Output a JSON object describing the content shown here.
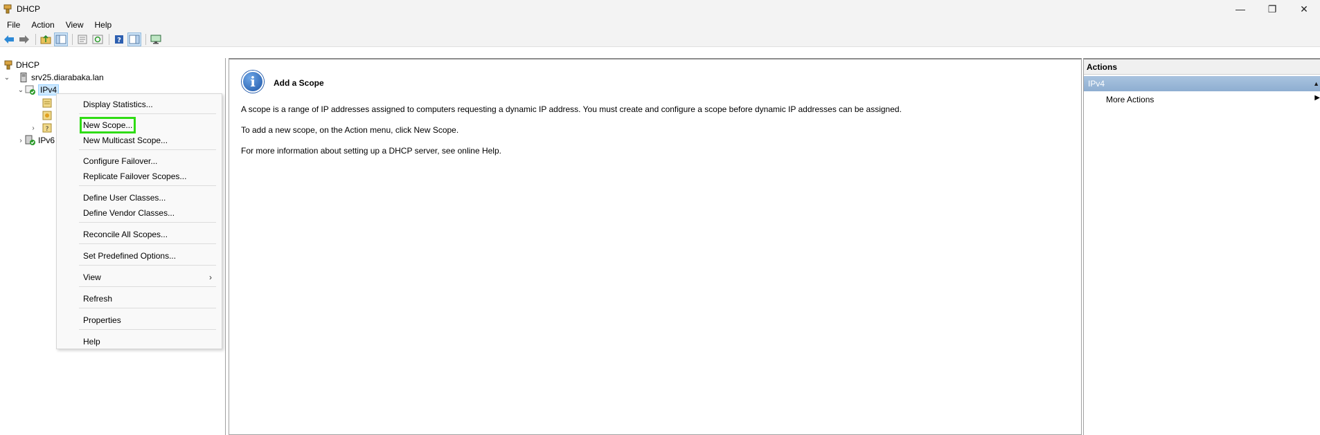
{
  "window": {
    "title": "DHCP",
    "controls": {
      "minimize": "—",
      "restore": "❐",
      "close": "✕"
    }
  },
  "menubar": {
    "items": [
      "File",
      "Action",
      "View",
      "Help"
    ]
  },
  "toolbar": {
    "buttons": [
      "back-arrow-icon",
      "forward-arrow-icon",
      "up-folder-icon",
      "show-hide-tree-icon",
      "properties-icon",
      "refresh-icon",
      "help-icon",
      "show-hide-action-pane-icon",
      "monitor-icon"
    ]
  },
  "tree": {
    "root": "DHCP",
    "server": "srv25.diarabaka.lan",
    "ipv4": "IPv4",
    "ipv6": "IPv6"
  },
  "context_menu": {
    "items": [
      {
        "label": "Display Statistics...",
        "has_submenu": false
      },
      {
        "label": "New Scope...",
        "has_submenu": false,
        "highlighted": true
      },
      {
        "label": "New Multicast Scope...",
        "has_submenu": false
      },
      {
        "label": "Configure Failover...",
        "has_submenu": false
      },
      {
        "label": "Replicate Failover Scopes...",
        "has_submenu": false
      },
      {
        "label": "Define User Classes...",
        "has_submenu": false
      },
      {
        "label": "Define Vendor Classes...",
        "has_submenu": false
      },
      {
        "label": "Reconcile All Scopes...",
        "has_submenu": false
      },
      {
        "label": "Set Predefined Options...",
        "has_submenu": false
      },
      {
        "label": "View",
        "has_submenu": true
      },
      {
        "label": "Refresh",
        "has_submenu": false
      },
      {
        "label": "Properties",
        "has_submenu": false
      },
      {
        "label": "Help",
        "has_submenu": false
      }
    ],
    "submenu_arrow": "›"
  },
  "main": {
    "heading": "Add a Scope",
    "info_glyph": "i",
    "paragraphs": [
      "A scope is a range of IP addresses assigned to computers requesting a dynamic IP address. You must create and configure a scope before dynamic IP addresses can be assigned.",
      "To add a new scope, on the Action menu, click New Scope.",
      "For more information about setting up a DHCP server, see online Help."
    ]
  },
  "actions": {
    "header": "Actions",
    "section": "IPv4",
    "items": [
      "More Actions"
    ]
  },
  "colors": {
    "highlight_outline": "#2fdc14",
    "selection_bg": "#cce8ff",
    "actions_section_bg": "#8eaed1"
  }
}
